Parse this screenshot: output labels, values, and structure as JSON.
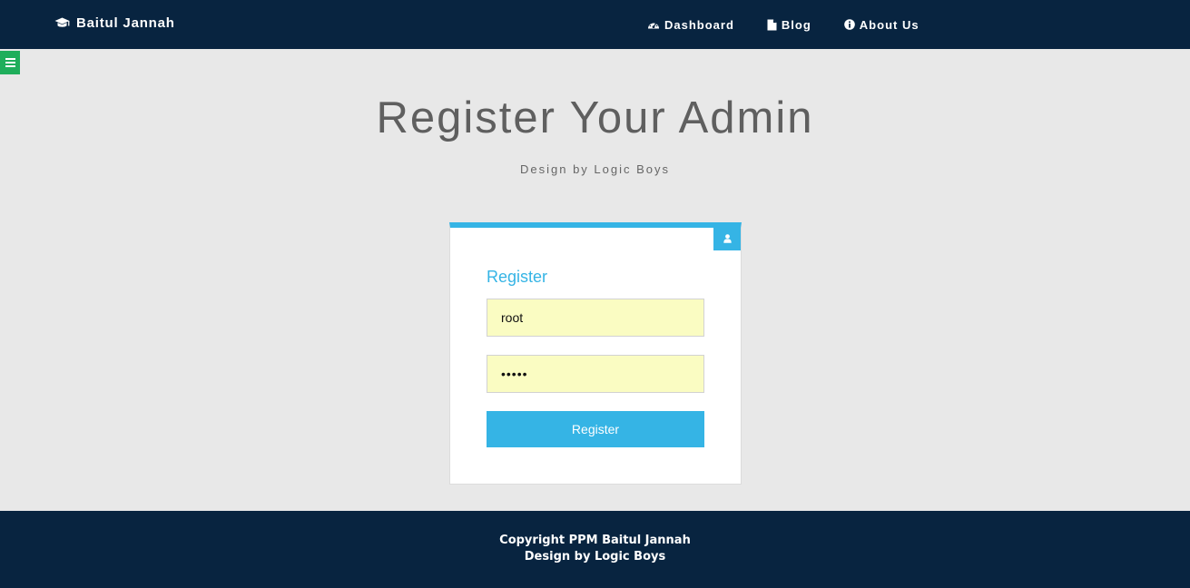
{
  "navbar": {
    "brand": {
      "icon": "graduation-cap-icon",
      "label": "Baitul Jannah"
    },
    "links": [
      {
        "icon": "dashboard-icon",
        "label": "Dashboard"
      },
      {
        "icon": "file-icon",
        "label": "Blog"
      },
      {
        "icon": "info-circle-icon",
        "label": "About Us"
      }
    ]
  },
  "sidebar_toggle": {
    "icon": "menu-icon"
  },
  "header": {
    "title": "Register Your Admin",
    "subtitle": "Design by Logic Boys"
  },
  "register_card": {
    "corner_icon": "user-icon",
    "heading": "Register",
    "username_value": "root",
    "password_value": "rootx",
    "submit_label": "Register"
  },
  "footer": {
    "line1": "Copyright PPM Baitul Jannah",
    "line2": "Design by Logic Boys"
  },
  "colors": {
    "navbar_bg": "#082440",
    "accent": "#35b4e5",
    "toggle": "#1fae5b",
    "page_bg": "#e8e8e8",
    "input_bg": "#fafcc2"
  }
}
